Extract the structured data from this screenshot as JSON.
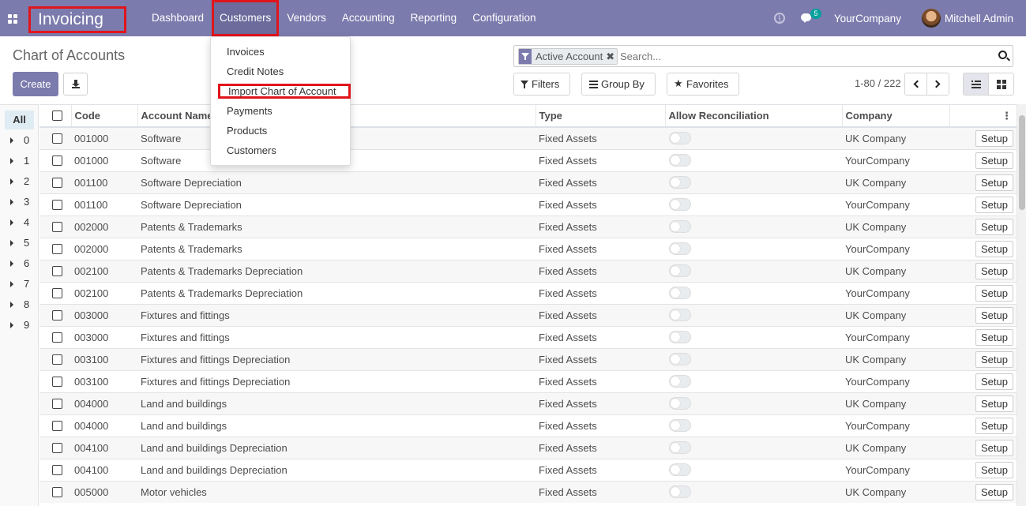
{
  "navbar": {
    "app_name": "Invoicing",
    "menu": [
      "Dashboard",
      "Customers",
      "Vendors",
      "Accounting",
      "Reporting",
      "Configuration"
    ],
    "active_menu": "Customers",
    "chat_badge": "5",
    "company": "YourCompany",
    "user": "Mitchell Admin"
  },
  "customers_dropdown": {
    "items": [
      "Invoices",
      "Credit Notes",
      "Import Chart of Account",
      "Payments",
      "Products",
      "Customers"
    ],
    "highlighted": "Import Chart of Account"
  },
  "control_panel": {
    "breadcrumb": "Chart of Accounts",
    "create_label": "Create",
    "search_facet": "Active Account",
    "search_placeholder": "Search...",
    "filters_label": "Filters",
    "groupby_label": "Group By",
    "favorites_label": "Favorites",
    "pager": "1-80 / 222"
  },
  "side_panel": {
    "all_label": "All",
    "items": [
      "0",
      "1",
      "2",
      "3",
      "4",
      "5",
      "6",
      "7",
      "8",
      "9"
    ]
  },
  "table": {
    "columns": [
      "Code",
      "Account Name",
      "Type",
      "Allow Reconciliation",
      "Company"
    ],
    "setup_label": "Setup",
    "rows": [
      {
        "code": "001000",
        "name": "Software",
        "type": "Fixed Assets",
        "company": "UK Company"
      },
      {
        "code": "001000",
        "name": "Software",
        "type": "Fixed Assets",
        "company": "YourCompany"
      },
      {
        "code": "001100",
        "name": "Software Depreciation",
        "type": "Fixed Assets",
        "company": "UK Company"
      },
      {
        "code": "001100",
        "name": "Software Depreciation",
        "type": "Fixed Assets",
        "company": "YourCompany"
      },
      {
        "code": "002000",
        "name": "Patents & Trademarks",
        "type": "Fixed Assets",
        "company": "UK Company"
      },
      {
        "code": "002000",
        "name": "Patents & Trademarks",
        "type": "Fixed Assets",
        "company": "YourCompany"
      },
      {
        "code": "002100",
        "name": "Patents & Trademarks Depreciation",
        "type": "Fixed Assets",
        "company": "UK Company"
      },
      {
        "code": "002100",
        "name": "Patents & Trademarks Depreciation",
        "type": "Fixed Assets",
        "company": "YourCompany"
      },
      {
        "code": "003000",
        "name": "Fixtures and fittings",
        "type": "Fixed Assets",
        "company": "UK Company"
      },
      {
        "code": "003000",
        "name": "Fixtures and fittings",
        "type": "Fixed Assets",
        "company": "YourCompany"
      },
      {
        "code": "003100",
        "name": "Fixtures and fittings Depreciation",
        "type": "Fixed Assets",
        "company": "UK Company"
      },
      {
        "code": "003100",
        "name": "Fixtures and fittings Depreciation",
        "type": "Fixed Assets",
        "company": "YourCompany"
      },
      {
        "code": "004000",
        "name": "Land and buildings",
        "type": "Fixed Assets",
        "company": "UK Company"
      },
      {
        "code": "004000",
        "name": "Land and buildings",
        "type": "Fixed Assets",
        "company": "YourCompany"
      },
      {
        "code": "004100",
        "name": "Land and buildings Depreciation",
        "type": "Fixed Assets",
        "company": "UK Company"
      },
      {
        "code": "004100",
        "name": "Land and buildings Depreciation",
        "type": "Fixed Assets",
        "company": "YourCompany"
      },
      {
        "code": "005000",
        "name": "Motor vehicles",
        "type": "Fixed Assets",
        "company": "UK Company"
      }
    ]
  },
  "colors": {
    "brand": "#7c7bad",
    "highlight_border": "#e0151b"
  }
}
